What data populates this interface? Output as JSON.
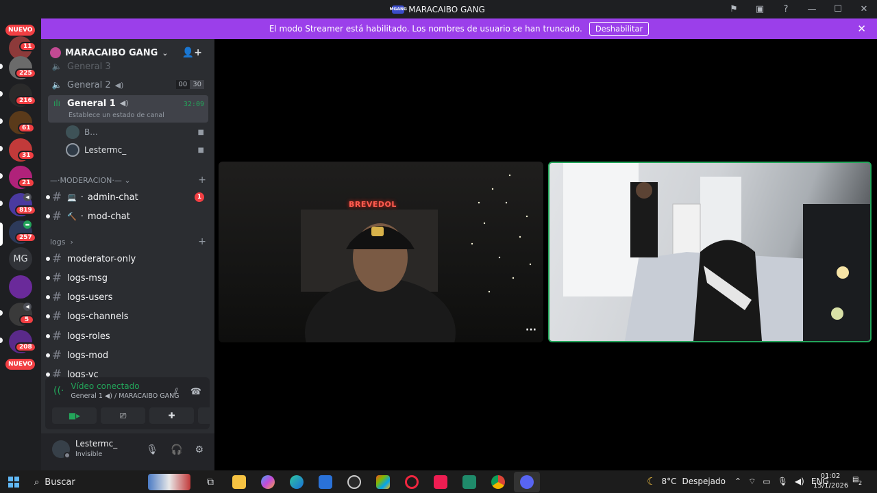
{
  "window": {
    "title": "MARACAIBO GANG",
    "logo_text": "MGANG"
  },
  "banner": {
    "message": "El modo Streamer está habilitado. Los nombres de usuario se han truncado.",
    "button": "Deshabilitar"
  },
  "rail": {
    "nuevo_top": "NUEVO",
    "nuevo_bottom": "NUEVO",
    "counts": [
      "11",
      "225",
      "216",
      "61",
      "31",
      "21",
      "819",
      "257",
      "5",
      "208"
    ],
    "initials": "MG"
  },
  "server": {
    "name": "MARACAIBO GANG"
  },
  "channels": {
    "general3": {
      "name": "General 3"
    },
    "general2": {
      "name": "General 2",
      "count_a": "00",
      "count_b": "30"
    },
    "general1": {
      "name": "General 1",
      "timer": "32:09",
      "status": "Establece un estado de canal"
    },
    "users": [
      "B...",
      "Lestermc_"
    ],
    "category_mod": "MODERACION",
    "admin_chat": {
      "name": "admin-chat",
      "badge": "1"
    },
    "mod_chat": {
      "name": "mod-chat"
    },
    "category_logs": "logs",
    "logs": [
      "moderator-only",
      "logs-msg",
      "logs-users",
      "logs-channels",
      "logs-roles",
      "logs-mod",
      "logs-vc"
    ]
  },
  "voice_panel": {
    "title": "Vídeo conectado",
    "subtitle": "General 1",
    "subtitle_server": "MARACAIBO GANG"
  },
  "user_panel": {
    "name": "Lestermc_",
    "status": "Invisible"
  },
  "stage": {
    "neon_text": "BREVEDOL",
    "more": "···"
  },
  "taskbar": {
    "search": "Buscar",
    "weather": "8°C",
    "weather_desc": "Despejado",
    "lang": "ENG",
    "time": "01:02",
    "date": "15/1/2026",
    "notifications": "2"
  }
}
